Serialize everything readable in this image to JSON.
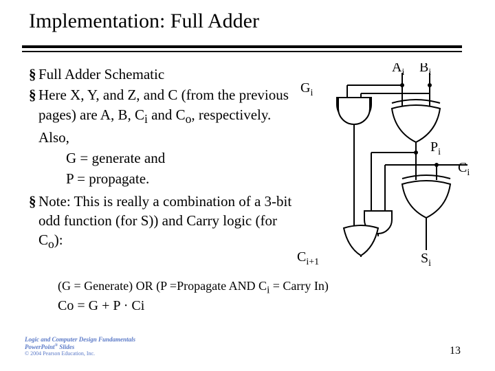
{
  "title": "Implementation: Full Adder",
  "bullets": {
    "b1": "Full Adder Schematic",
    "b2": "Here X, Y, and Z, and C (from the previous pages) are A, B, C",
    "b2_sub1": "i",
    "b2_mid": " and C",
    "b2_sub2": "o",
    "b2_end": ", respectively. Also,",
    "g_line": "G = generate and",
    "p_line": "P = propagate.",
    "b3": "Note:   This is really a combination of a 3-bit odd function (for S)) and Carry logic (for C",
    "b3_sub": "o",
    "b3_end": "):"
  },
  "note": {
    "pre": "(G = Generate) OR (P =Propagate AND C",
    "sub": "i",
    "post": " = Carry In)"
  },
  "eq": "Co = G + P · Ci",
  "logo": {
    "l1a": "Logic and Computer Design Fundamentals",
    "l1b": "PowerPoint",
    "sup": "®",
    "l1c": " Slides",
    "l2": "© 2004 Pearson Education, Inc."
  },
  "slidenum": "13",
  "labels": {
    "Gi_main": "G",
    "Gi_sub": "i",
    "Ai_main": "A",
    "Ai_sub": "i",
    "Bi_main": "B",
    "Bi_sub": "i",
    "Pi_main": "P",
    "Pi_sub": "i",
    "Ci_main": "C",
    "Ci_sub": "i",
    "Ci1_main": "C",
    "Ci1_sub": "i+1",
    "Si_main": "S",
    "Si_sub": "i"
  }
}
